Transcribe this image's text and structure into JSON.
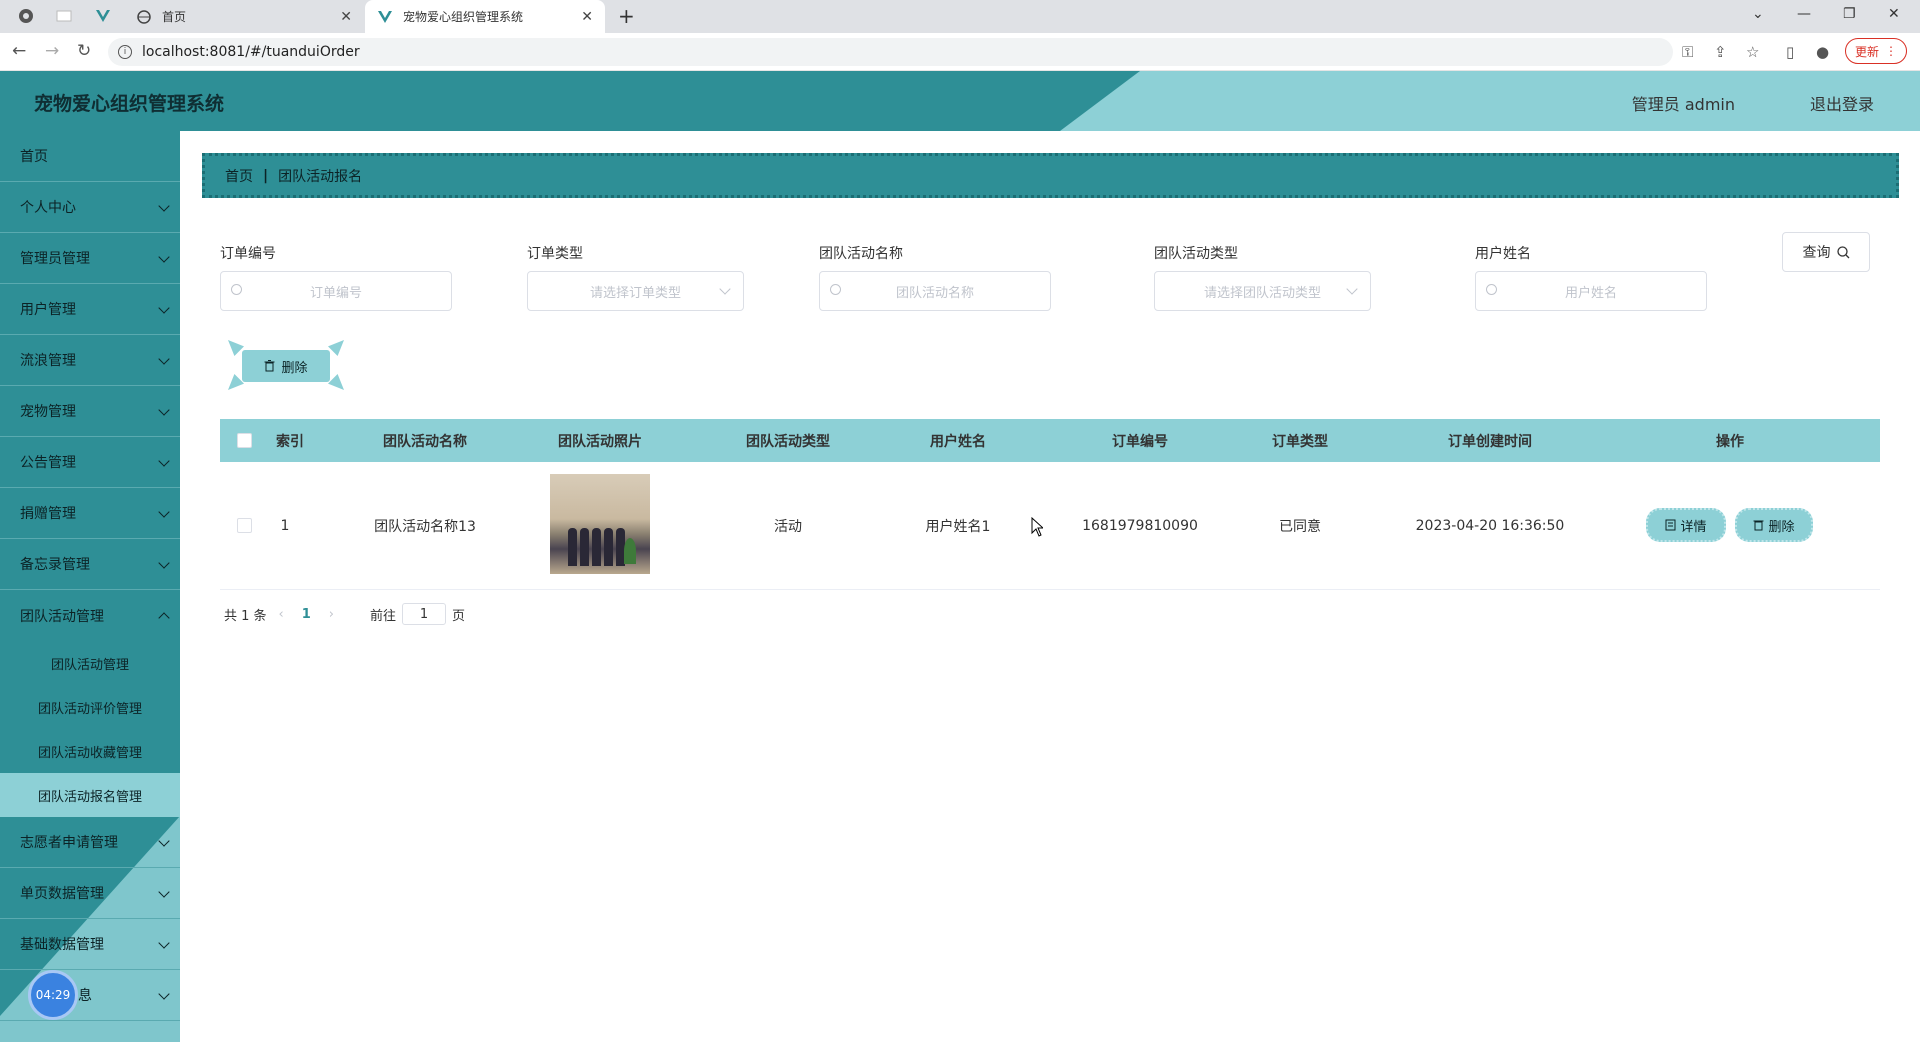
{
  "browser": {
    "tabs": [
      {
        "title": "首页",
        "active": false
      },
      {
        "title": "宠物爱心组织管理系统",
        "active": true
      }
    ],
    "url": "localhost:8081/#/tuanduiOrder",
    "update_label": "更新"
  },
  "header": {
    "title": "宠物爱心组织管理系统",
    "user": "管理员 admin",
    "logout": "退出登录"
  },
  "sidebar": {
    "items": [
      {
        "label": "首页"
      },
      {
        "label": "个人中心"
      },
      {
        "label": "管理员管理"
      },
      {
        "label": "用户管理"
      },
      {
        "label": "流浪管理"
      },
      {
        "label": "宠物管理"
      },
      {
        "label": "公告管理"
      },
      {
        "label": "捐赠管理"
      },
      {
        "label": "备忘录管理"
      },
      {
        "label": "团队活动管理"
      },
      {
        "label": "志愿者申请管理"
      },
      {
        "label": "单页数据管理"
      },
      {
        "label": "基础数据管理"
      },
      {
        "label": "息"
      }
    ],
    "sub_items": [
      {
        "label": "团队活动管理"
      },
      {
        "label": "团队活动评价管理"
      },
      {
        "label": "团队活动收藏管理"
      },
      {
        "label": "团队活动报名管理"
      }
    ],
    "clock": "04:29"
  },
  "breadcrumb": {
    "home": "首页",
    "current": "团队活动报名"
  },
  "search": {
    "fields": [
      {
        "label": "订单编号",
        "placeholder": "订单编号"
      },
      {
        "label": "订单类型",
        "placeholder": "请选择订单类型"
      },
      {
        "label": "团队活动名称",
        "placeholder": "团队活动名称"
      },
      {
        "label": "团队活动类型",
        "placeholder": "请选择团队活动类型"
      },
      {
        "label": "用户姓名",
        "placeholder": "用户姓名"
      }
    ],
    "query_label": "查询"
  },
  "actions": {
    "delete_label": "删除"
  },
  "table": {
    "headers": [
      "索引",
      "团队活动名称",
      "团队活动照片",
      "团队活动类型",
      "用户姓名",
      "订单编号",
      "订单类型",
      "订单创建时间",
      "操作"
    ],
    "rows": [
      {
        "index": "1",
        "name": "团队活动名称13",
        "type": "活动",
        "user": "用户姓名1",
        "order_no": "1681979810090",
        "order_type": "已同意",
        "created": "2023-04-20 16:36:50",
        "detail_label": "详情",
        "delete_label": "删除"
      }
    ]
  },
  "pagination": {
    "total": "共 1 条",
    "current": "1",
    "goto_prefix": "前往",
    "goto_value": "1",
    "goto_suffix": "页"
  },
  "colors": {
    "primary": "#2e8f96",
    "accent": "#8dd0d6"
  }
}
